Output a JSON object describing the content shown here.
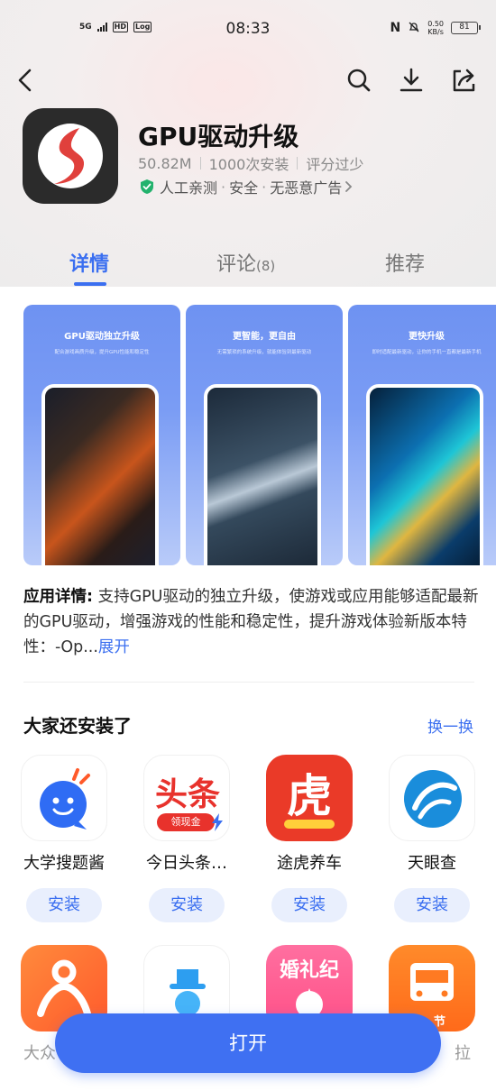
{
  "status_bar": {
    "network": "5G",
    "hd": "HD",
    "log": "Log",
    "time": "08:33",
    "nfc": "N",
    "speed_value": "0.50",
    "speed_unit": "KB/s",
    "battery": "81"
  },
  "nav": {
    "back_icon": "chevron-left-icon",
    "search_icon": "search-icon",
    "download_icon": "download-icon",
    "share_icon": "share-icon"
  },
  "app": {
    "title": "GPU驱动升级",
    "size": "50.82M",
    "installs": "1000次安装",
    "rating": "评分过少",
    "tags": [
      "人工亲测",
      "安全",
      "无恶意广告"
    ],
    "icon_color": "#e0403c"
  },
  "tabs": [
    {
      "label": "详情"
    },
    {
      "label": "评论",
      "count": "(8)"
    },
    {
      "label": "推荐"
    }
  ],
  "screenshots": [
    {
      "title": "GPU驱动独立升级",
      "subtitle": "配合游戏画质升级，提升GPU性能和稳定性"
    },
    {
      "title": "更智能，更自由",
      "subtitle": "无需繁琐的系统升级，就能体验到最新驱动"
    },
    {
      "title": "更快升级",
      "subtitle": "即时适配最新驱动，让你的手机一直都是最新手机"
    }
  ],
  "description": {
    "label": "应用详情:",
    "text": " 支持GPU驱动的独立升级，使游戏或应用能够适配最新的GPU驱动，增强游戏的性能和稳定性，提升游戏体验新版本特性：-Op...",
    "more": "展开"
  },
  "recommend": {
    "title": "大家还安装了",
    "refresh": "换一换",
    "install_label": "安装",
    "apps": [
      {
        "name": "大学搜题酱"
      },
      {
        "name": "今日头条…",
        "icon_text": "头条",
        "icon_badge": "领现金"
      },
      {
        "name": "途虎养车",
        "icon_text": "虎"
      },
      {
        "name": "天眼查"
      }
    ],
    "partial_apps": [
      {
        "name": "大众"
      },
      {
        "name": "",
        "icon_text": "婚礼纪"
      },
      {
        "name": "拉",
        "icon_badge": "节"
      }
    ]
  },
  "open_button": "打开",
  "colors": {
    "accent": "#3b6ff0",
    "install_bg": "#e9effd"
  }
}
